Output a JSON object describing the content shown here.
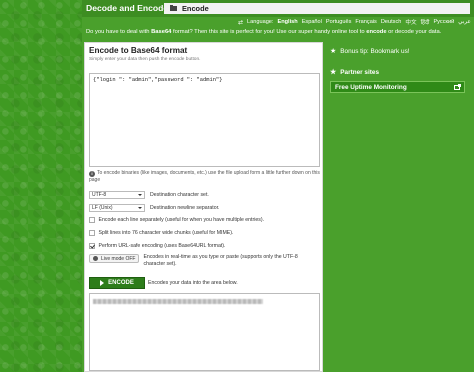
{
  "site": {
    "title": "Decode and Encode"
  },
  "breadcrumb": {
    "label": "Encode"
  },
  "languages": {
    "label": "Language:",
    "items": [
      "English",
      "Español",
      "Português",
      "Français",
      "Deutsch",
      "中文",
      "हिंदी",
      "Русский",
      "عربي"
    ]
  },
  "intro": {
    "pre": "Do you have to deal with ",
    "b1": "Base64",
    "mid": " format? Then this site is perfect for you! Use our super handy online tool to ",
    "b2": "encode",
    "post": " or decode your data."
  },
  "panel": {
    "title": "Encode to Base64 format",
    "subtitle": "Simply enter your data then push the encode button.",
    "input_value": "{\"login \": \"admin\",\"password \": \"admin\"}",
    "hint": "To encode binaries (like images, documents, etc.) use the file upload form a little further down on this page",
    "charset": {
      "value": "UTF-8",
      "label": "Destination character set."
    },
    "newline": {
      "value": "LF (Unix)",
      "label": "Destination newline separator."
    },
    "options": [
      {
        "label": "Encode each line separately (useful for when you have multiple entries).",
        "checked": false
      },
      {
        "label": "Split lines into 76 character wide chunks (useful for MIME).",
        "checked": false
      },
      {
        "label": "Perform URL-safe encoding (uses Base64URL format).",
        "checked": true
      }
    ],
    "live_mode": {
      "button": "Live mode OFF",
      "text": "Encodes in real-time as you type or paste (supports only the UTF-8 character set)."
    },
    "encode_button": "ENCODE",
    "encode_note": "Encodes your data into the area below."
  },
  "sidebar": {
    "bonus": "Bonus tip: Bookmark us!",
    "partner_title": "Partner sites",
    "partner_link": "Free Uptime Monitoring"
  },
  "colors": {
    "brand_green": "#4aa02c",
    "dark_green": "#2d7d1a"
  }
}
